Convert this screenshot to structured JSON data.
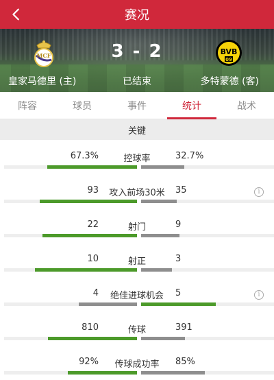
{
  "header": {
    "title": "赛况"
  },
  "match": {
    "score": "3 - 2",
    "status": "已结束",
    "home": {
      "name": "皇家马德里 (主)"
    },
    "away": {
      "name": "多特蒙德 (客)",
      "crest_text": "BVB",
      "crest_sub": "09"
    }
  },
  "tabs": [
    {
      "label": "阵容"
    },
    {
      "label": "球员"
    },
    {
      "label": "事件"
    },
    {
      "label": "统计",
      "active": true
    },
    {
      "label": "战术"
    }
  ],
  "section_title": "关键",
  "colors": {
    "accent": "#d0283b",
    "win_bar": "#4c9a2a",
    "lose_bar": "#8e8e8e",
    "away_crest": "#f7d308"
  },
  "stats": [
    {
      "label": "控球率",
      "home": "67.3%",
      "away": "32.7%",
      "home_share": 0.673,
      "away_share": 0.327,
      "home_leads": true,
      "info": false
    },
    {
      "label": "攻入前场30米",
      "home": "93",
      "away": "35",
      "home_share": 0.73,
      "away_share": 0.27,
      "home_leads": true,
      "info": true
    },
    {
      "label": "射门",
      "home": "22",
      "away": "9",
      "home_share": 0.71,
      "away_share": 0.29,
      "home_leads": true,
      "info": false
    },
    {
      "label": "射正",
      "home": "10",
      "away": "3",
      "home_share": 0.77,
      "away_share": 0.23,
      "home_leads": true,
      "info": false
    },
    {
      "label": "绝佳进球机会",
      "home": "4",
      "away": "5",
      "home_share": 0.44,
      "away_share": 0.56,
      "home_leads": false,
      "info": true
    },
    {
      "label": "传球",
      "home": "810",
      "away": "391",
      "home_share": 0.67,
      "away_share": 0.33,
      "home_leads": true,
      "info": false
    },
    {
      "label": "传球成功率",
      "home": "92%",
      "away": "85%",
      "home_share": 0.52,
      "away_share": 0.48,
      "home_leads": true,
      "info": false
    }
  ]
}
